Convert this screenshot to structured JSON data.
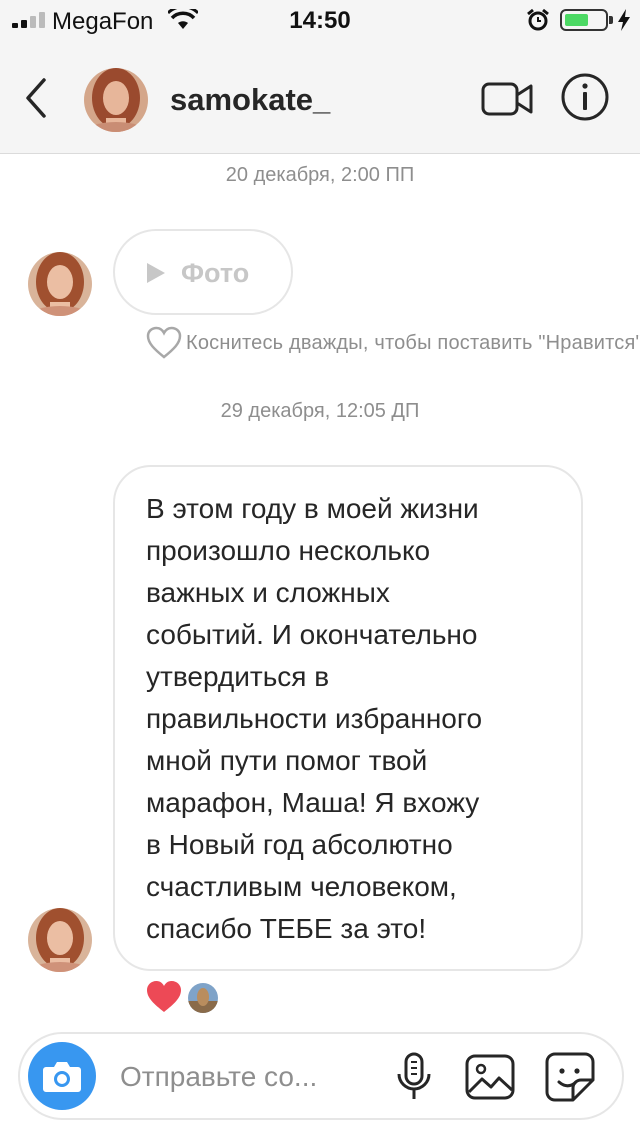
{
  "status_bar": {
    "carrier": "MegaFon",
    "time": "14:50",
    "battery_level": 0.6,
    "battery_color": "#4cd964",
    "icons": [
      "signal-icon",
      "wifi-icon",
      "alarm-icon",
      "battery-icon",
      "charging-icon"
    ]
  },
  "header": {
    "username": "samokate_",
    "icons": [
      "chevron-left-icon",
      "video-camera-icon",
      "info-icon"
    ]
  },
  "thread": {
    "timestamp_1": "20 декабря, 2:00 ПП",
    "photo_label": "Фото",
    "like_hint": "Коснитесь дважды, чтобы поставить \"Нравится\"",
    "timestamp_2": "29 декабря, 12:05 ДП",
    "message_text": "В этом году в моей жизни\nпроизошло несколько\nважных и сложных\nсобытий. И окончательно\nутвердиться в\nправильности избранного\nмной пути помог твой\nмарафон, Маша! Я вхожу\nв Новый год абсолютно\nсчастливым человеком,\nспасибо ТЕБЕ за это!",
    "reaction_color": "#ed4956"
  },
  "composer": {
    "placeholder": "Отправьте со...",
    "accent": "#3897f0",
    "icons": [
      "camera-icon",
      "microphone-icon",
      "gallery-icon",
      "sticker-icon"
    ]
  }
}
